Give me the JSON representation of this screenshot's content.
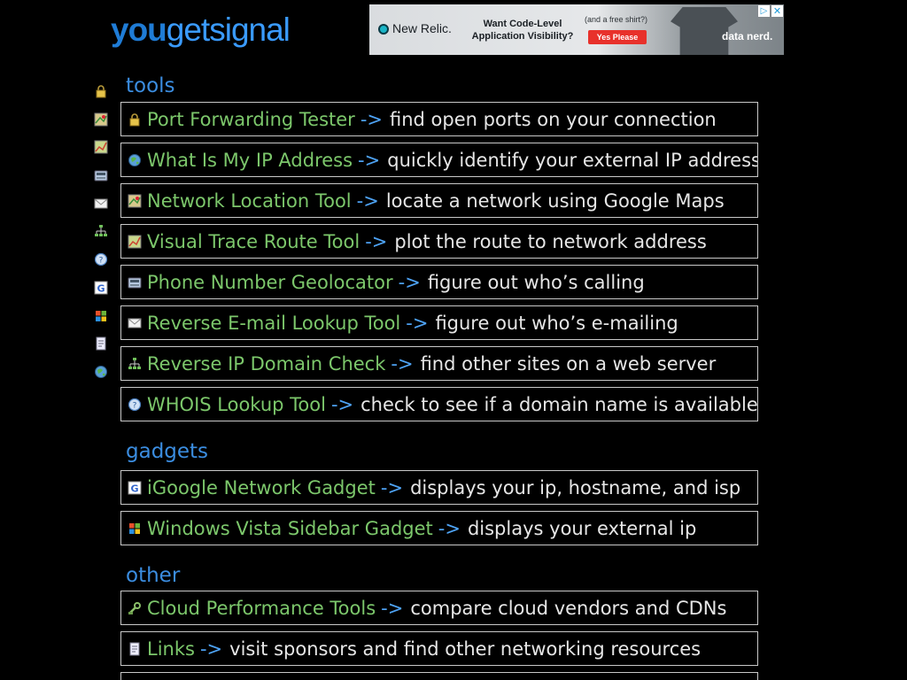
{
  "logo": {
    "you": "you",
    "get": "get",
    "signal": "signal"
  },
  "ad": {
    "brand": "New Relic.",
    "headline": "Want Code-Level Application Visibility?",
    "aside": "(and a free shirt?)",
    "cta": "Yes Please",
    "tagline": "data nerd."
  },
  "colors": {
    "background": "#000000",
    "section_title": "#3b8de0",
    "tool_name": "#7cc76b",
    "arrow": "#4ea3f5",
    "description": "#e6e6e6",
    "border": "#c8c8c8"
  },
  "sections": {
    "tools": {
      "title": "tools",
      "items": [
        {
          "name": "Port Forwarding Tester",
          "arrow": "->",
          "desc": "find open ports on your connection",
          "icon": "lock-icon"
        },
        {
          "name": "What Is My IP Address",
          "arrow": "->",
          "desc": "quickly identify your external IP address",
          "icon": "globe-icon"
        },
        {
          "name": "Network Location Tool",
          "arrow": "->",
          "desc": "locate a network using Google Maps",
          "icon": "map-icon"
        },
        {
          "name": "Visual Trace Route Tool",
          "arrow": "->",
          "desc": "plot the route to network address",
          "icon": "route-map-icon"
        },
        {
          "name": "Phone Number Geolocator",
          "arrow": "->",
          "desc": "figure out who’s calling",
          "icon": "phone-icon"
        },
        {
          "name": "Reverse E-mail Lookup Tool",
          "arrow": "->",
          "desc": "figure out who’s e-mailing",
          "icon": "envelope-icon"
        },
        {
          "name": "Reverse IP Domain Check",
          "arrow": "->",
          "desc": "find other sites on a web server",
          "icon": "network-tree-icon"
        },
        {
          "name": "WHOIS Lookup Tool",
          "arrow": "->",
          "desc": "check to see if a domain name is available",
          "icon": "whois-icon"
        }
      ]
    },
    "gadgets": {
      "title": "gadgets",
      "items": [
        {
          "name": "iGoogle Network Gadget",
          "arrow": "->",
          "desc": "displays your ip, hostname, and isp",
          "icon": "google-g-icon"
        },
        {
          "name": "Windows Vista Sidebar Gadget",
          "arrow": "->",
          "desc": "displays your external ip",
          "icon": "windows-flag-icon"
        }
      ]
    },
    "other": {
      "title": "other",
      "items": [
        {
          "name": "Cloud Performance Tools",
          "arrow": "->",
          "desc": "compare cloud vendors and CDNs",
          "icon": "cloud-tools-icon"
        },
        {
          "name": "Links",
          "arrow": "->",
          "desc": "visit sponsors and find other networking resources",
          "icon": "document-icon"
        }
      ]
    }
  },
  "sidebar": {
    "icons": [
      "lock-icon",
      "map-icon",
      "route-map-icon",
      "phone-icon",
      "envelope-icon",
      "network-tree-icon",
      "whois-icon",
      "google-g-icon",
      "windows-flag-icon",
      "document-icon",
      "globe-icon"
    ]
  }
}
